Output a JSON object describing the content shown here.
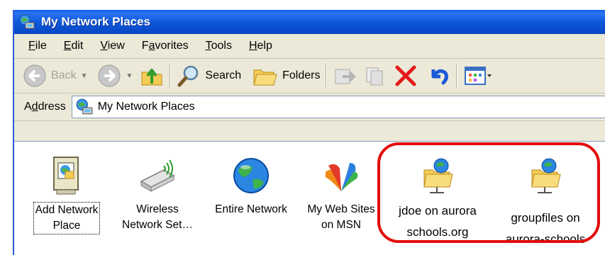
{
  "window": {
    "title": "My Network Places"
  },
  "menu": {
    "items": [
      {
        "pre": "",
        "key": "F",
        "post": "ile"
      },
      {
        "pre": "",
        "key": "E",
        "post": "dit"
      },
      {
        "pre": "",
        "key": "V",
        "post": "iew"
      },
      {
        "pre": "F",
        "key": "a",
        "post": "vorites"
      },
      {
        "pre": "",
        "key": "T",
        "post": "ools"
      },
      {
        "pre": "",
        "key": "H",
        "post": "elp"
      }
    ]
  },
  "toolbar": {
    "back_label": "Back",
    "search_label": "Search",
    "folders_label": "Folders"
  },
  "address": {
    "label_pre": "A",
    "label_key": "d",
    "label_post": "dress",
    "value": "My Network Places"
  },
  "items": [
    {
      "line1": "Add Network",
      "line2": "Place"
    },
    {
      "line1": "Wireless",
      "line2": "Network Set…"
    },
    {
      "line1": "Entire Network",
      "line2": ""
    },
    {
      "line1": "My Web Sites",
      "line2": "on MSN"
    },
    {
      "line1": "jdoe on aurora",
      "line2": "schools.org"
    },
    {
      "line1": "groupfiles on",
      "line2": "aurora-schools"
    }
  ],
  "colors": {
    "titlebar": "#0a58e6",
    "highlight": "#e30c0c",
    "close_x": "#e41b1b"
  }
}
